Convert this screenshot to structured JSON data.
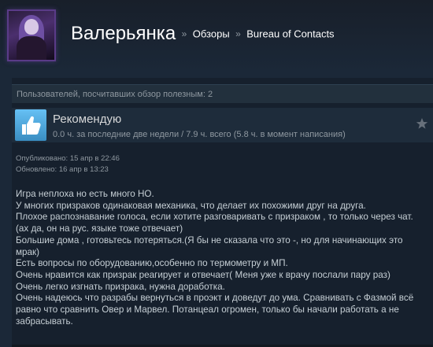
{
  "header": {
    "user_name": "Валерьянка",
    "separator": "»",
    "breadcrumb_reviews": "Обзоры",
    "breadcrumb_game": "Bureau of Contacts"
  },
  "review": {
    "helpful_text": "Пользователей, посчитавших обзор полезным: 2",
    "recommendation": "Рекомендую",
    "hours": "0.0 ч. за последние две недели / 7.9 ч. всего (5.8 ч. в момент написания)",
    "published_label": "Опубликовано:",
    "published_value": "15 апр в 22:46",
    "updated_label": "Обновлено:",
    "updated_value": "16 апр в 13:23",
    "body_lines": [
      "Игра неплоха но есть много НО.",
      "У многих призраков одинаковая механика, что делает их похожими друг на друга.",
      "Плохое распознавание голоса, если хотите разговаривать с призраком , то только через чат.",
      "(ах да, он на рус. языке тоже отвечает)",
      "Большие дома , готовьтесь потеряться.(Я бы не сказала что это -, но для начинающих это",
      "мрак)",
      "Есть вопросы по оборудованию,особенно по термометру и МП.",
      "Очень нравится как призрак реагирует и отвечает( Меня уже к врачу послали пару раз)",
      "Очень легко изгнать призрака, нужна доработка.",
      "Очень надеюсь что разрабы вернуться в проэкт и доведут до ума. Сравнивать с Фазмой всё",
      "равно что сравнить Овер и Марвел. Потанцеал огромен, только бы начали работать а не",
      "забрасывать."
    ]
  },
  "colors": {
    "background": "#1b2838",
    "accent": "#66c0f4"
  },
  "icons": {
    "thumb": "thumbs-up-icon",
    "star": "star-icon"
  }
}
